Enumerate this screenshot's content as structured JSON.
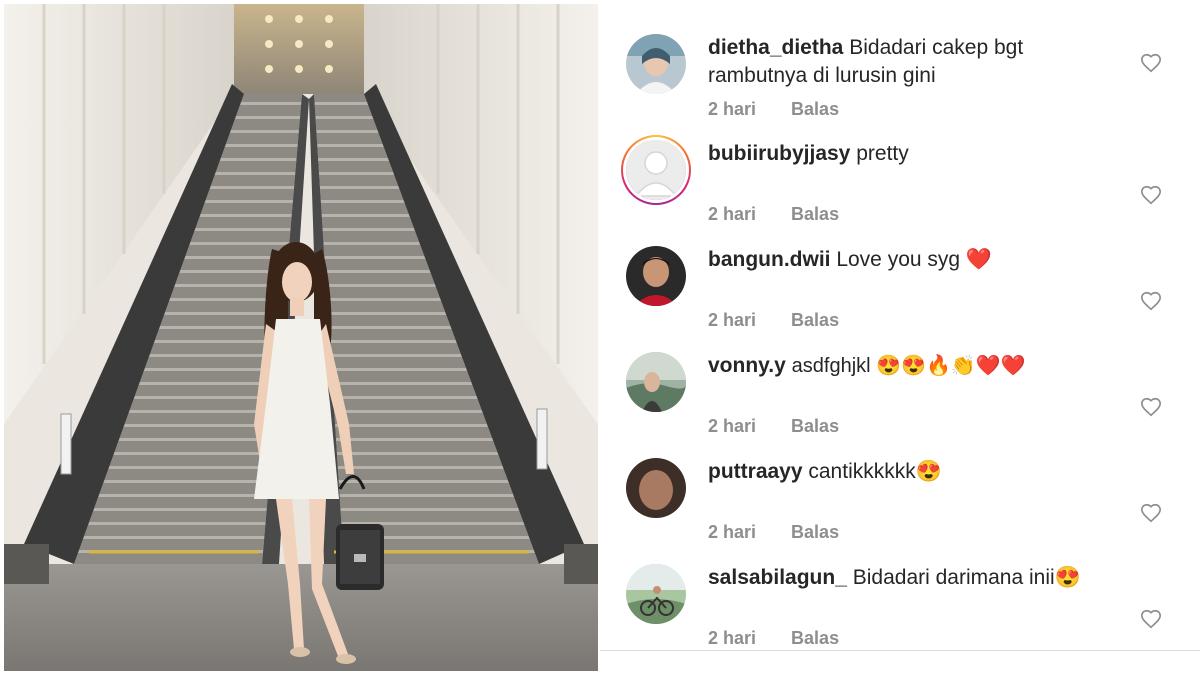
{
  "photo": {
    "description_icon": "photo-icon"
  },
  "comments": [
    {
      "username": "dietha_dietha",
      "text": "Bidadari cakep bgt rambutnya di lurusin gini",
      "time": "2 hari",
      "reply_label": "Balas",
      "has_story": false,
      "avatar_icon": "avatar-photo-icon"
    },
    {
      "username": "bubiirubyjjasy",
      "text": "pretty",
      "time": "2 hari",
      "reply_label": "Balas",
      "has_story": true,
      "avatar_icon": "default-avatar-icon"
    },
    {
      "username": "bangun.dwii",
      "text": "Love you syg ❤️",
      "time": "2 hari",
      "reply_label": "Balas",
      "has_story": false,
      "avatar_icon": "avatar-photo-icon"
    },
    {
      "username": "vonny.y",
      "text": "asdfghjkl 😍😍🔥👏❤️❤️",
      "time": "2 hari",
      "reply_label": "Balas",
      "has_story": false,
      "avatar_icon": "avatar-photo-icon"
    },
    {
      "username": "puttraayy",
      "text": "cantikkkkkk😍",
      "time": "2 hari",
      "reply_label": "Balas",
      "has_story": false,
      "avatar_icon": "avatar-photo-icon"
    },
    {
      "username": "salsabilagun_",
      "text": "Bidadari darimana inii😍",
      "time": "2 hari",
      "reply_label": "Balas",
      "has_story": false,
      "avatar_icon": "avatar-photo-icon"
    }
  ],
  "colors": {
    "username": "#262626",
    "meta": "#8e8e8e",
    "heart_outline": "#8e8e8e",
    "story_ring": "#d4246f"
  }
}
